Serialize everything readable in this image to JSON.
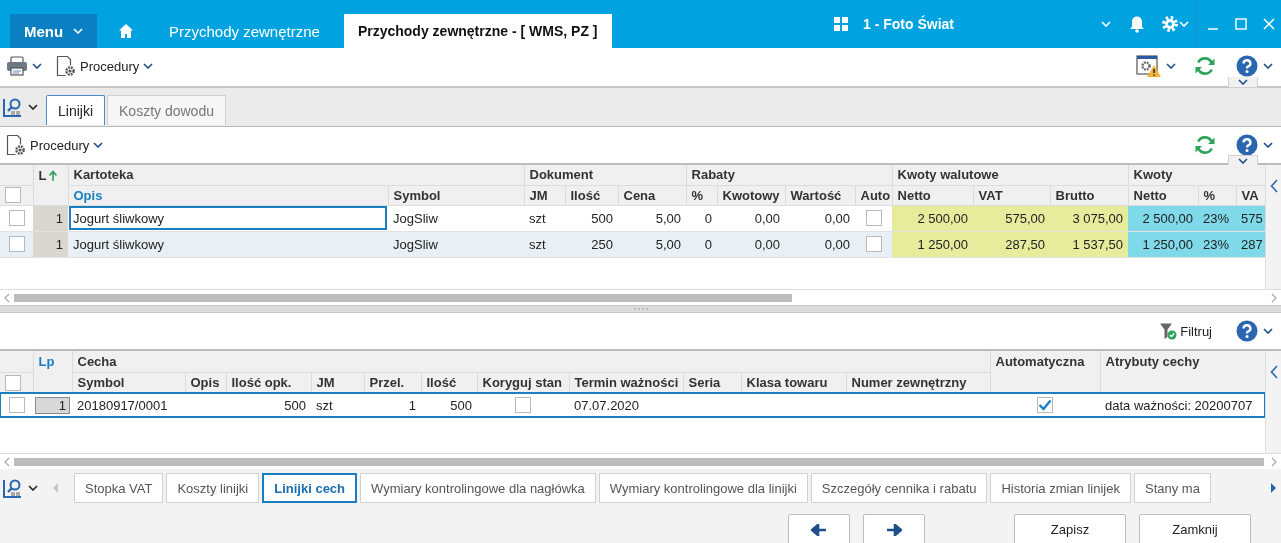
{
  "title_bar": {
    "menu": "Menu",
    "tabs": [
      {
        "label": "Przychody zewnętrzne",
        "selected": false
      },
      {
        "label": "Przychody zewnętrzne - [ WMS, PZ ]",
        "selected": true
      }
    ],
    "company": "1 - Foto Świat"
  },
  "toolbar": {
    "procedures": "Procedury"
  },
  "document_tabs": [
    {
      "label": "Linijki",
      "selected": true
    },
    {
      "label": "Koszty dowodu",
      "selected": false
    }
  ],
  "lines_toolbar": {
    "procedures": "Procedury"
  },
  "lines_grid": {
    "lp_header": "L",
    "select_all_checked": false,
    "groups": [
      {
        "label": "Kartoteka",
        "columns": [
          {
            "label": "Opis",
            "kind": "text",
            "active": true
          },
          {
            "label": "Symbol",
            "kind": "text",
            "active": false
          }
        ]
      },
      {
        "label": "Dokument",
        "columns": [
          {
            "label": "JM",
            "kind": "text",
            "active": false
          },
          {
            "label": "Ilość",
            "kind": "number",
            "active": false
          },
          {
            "label": "Cena",
            "kind": "number",
            "active": false
          }
        ]
      },
      {
        "label": "Rabaty",
        "columns": [
          {
            "label": "%",
            "kind": "number",
            "active": false
          },
          {
            "label": "Kwotowy",
            "kind": "number",
            "active": false
          },
          {
            "label": "Wartość",
            "kind": "number",
            "active": false
          },
          {
            "label": "Auto",
            "kind": "checkbox",
            "active": false
          }
        ]
      },
      {
        "label": "Kwoty walutowe",
        "color": "#e6ec9c",
        "columns": [
          {
            "label": "Netto",
            "kind": "number",
            "active": false
          },
          {
            "label": "VAT",
            "kind": "number",
            "active": false
          },
          {
            "label": "Brutto",
            "kind": "number",
            "active": false
          }
        ]
      },
      {
        "label": "Kwoty",
        "color": "#7fd9e9",
        "columns": [
          {
            "label": "Netto",
            "kind": "number",
            "active": false
          },
          {
            "label": "%",
            "kind": "text",
            "active": false
          },
          {
            "label": "VA",
            "kind": "text",
            "active": false
          }
        ]
      }
    ],
    "rows": [
      {
        "checked": false,
        "focused": true,
        "lp": "1",
        "cells": [
          "Jogurt śliwkowy",
          "JogSliw",
          "szt",
          "500",
          "5,00",
          "0",
          "0,00",
          "0,00",
          false,
          "2 500,00",
          "575,00",
          "3 075,00",
          "2 500,00",
          "23%",
          "575"
        ]
      },
      {
        "checked": false,
        "focused": false,
        "lp": "1",
        "cells": [
          "Jogurt śliwkowy",
          "JogSliw",
          "szt",
          "250",
          "5,00",
          "0",
          "0,00",
          "0,00",
          false,
          "1 250,00",
          "287,50",
          "1 537,50",
          "1 250,00",
          "23%",
          "287"
        ]
      }
    ]
  },
  "features_toolbar": {
    "filter": "Filtruj"
  },
  "features_grid": {
    "lp_header": "Lp",
    "select_all_checked": false,
    "groups": [
      {
        "label": "Cecha",
        "columns": [
          {
            "label": "Symbol",
            "kind": "text",
            "active": false
          },
          {
            "label": "Opis",
            "kind": "text",
            "active": false
          },
          {
            "label": "Ilość opk.",
            "kind": "number",
            "active": false
          },
          {
            "label": "JM",
            "kind": "text",
            "active": false
          },
          {
            "label": "Przel.",
            "kind": "number",
            "active": false
          },
          {
            "label": "Ilość",
            "kind": "number",
            "active": false
          },
          {
            "label": "Koryguj stan",
            "kind": "checkbox",
            "active": false
          },
          {
            "label": "Termin ważności",
            "kind": "text",
            "active": false
          },
          {
            "label": "Seria",
            "kind": "text",
            "active": false
          },
          {
            "label": "Klasa towaru",
            "kind": "text",
            "active": false
          },
          {
            "label": "Numer zewnętrzny",
            "kind": "text",
            "active": false
          }
        ]
      },
      {
        "label": "Automatyczna",
        "kind": "checkbox"
      },
      {
        "label": "Atrybuty cechy",
        "kind": "text"
      }
    ],
    "rows": [
      {
        "checked": false,
        "focused": true,
        "lp": "1",
        "cells": [
          "20180917/0001",
          null,
          "500",
          "szt",
          "1",
          "500",
          false,
          "07.07.2020",
          null,
          null,
          null,
          true,
          "data ważności: 20200707"
        ]
      }
    ]
  },
  "bottom_tabs": [
    {
      "label": "Stopka VAT",
      "selected": false
    },
    {
      "label": "Koszty linijki",
      "selected": false
    },
    {
      "label": "Linijki cech",
      "selected": true
    },
    {
      "label": "Wymiary kontrolingowe dla nagłówka",
      "selected": false
    },
    {
      "label": "Wymiary kontrolingowe dla linijki",
      "selected": false
    },
    {
      "label": "Szczegóły cennika i rabatu",
      "selected": false
    },
    {
      "label": "Historia zmian linijek",
      "selected": false
    },
    {
      "label": "Stany ma",
      "selected": false
    }
  ],
  "buttons": [
    "Zapisz",
    "Zamknij"
  ]
}
